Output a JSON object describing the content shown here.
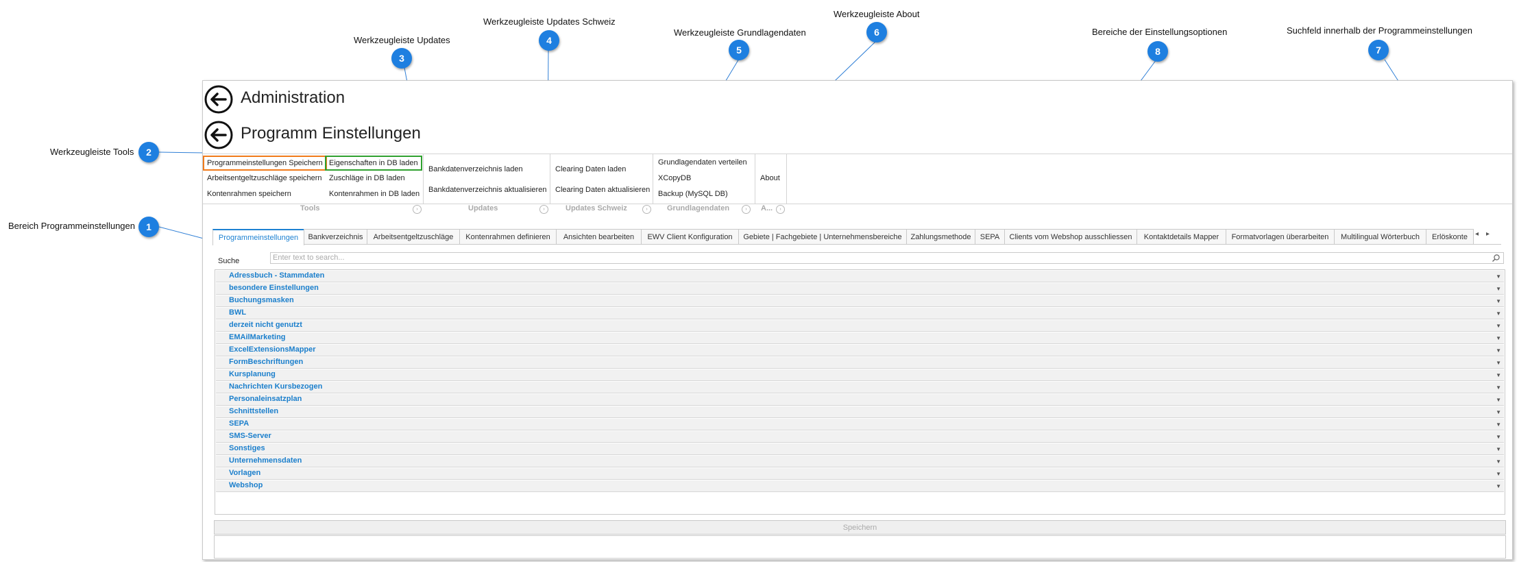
{
  "annotations": [
    {
      "num": "1",
      "label": "Bereich Programmeinstellungen"
    },
    {
      "num": "2",
      "label": "Werkzeugleiste Tools"
    },
    {
      "num": "3",
      "label": "Werkzeugleiste Updates"
    },
    {
      "num": "4",
      "label": "Werkzeugleiste Updates Schweiz"
    },
    {
      "num": "5",
      "label": "Werkzeugleiste Grundlagendaten"
    },
    {
      "num": "6",
      "label": "Werkzeugleiste About"
    },
    {
      "num": "7",
      "label": "Suchfeld innerhalb der Programmeinstellungen"
    },
    {
      "num": "8",
      "label": "Bereiche der Einstellungsoptionen"
    }
  ],
  "header": {
    "breadcrumb": "Administration",
    "title": "Programm Einstellungen"
  },
  "ribbon": {
    "tools": {
      "col1": [
        "Programmeinstellungen Speichern",
        "Arbeitsentgeltzuschläge speichern",
        "Kontenrahmen speichern"
      ],
      "col2": [
        "Eigenschaften in DB laden",
        "Zuschläge in DB laden",
        "Kontenrahmen in DB laden"
      ]
    },
    "updates": [
      "Bankdatenverzeichnis laden",
      "Bankdatenverzeichnis aktualisieren"
    ],
    "updates_schweiz": [
      "Clearing Daten laden",
      "Clearing Daten aktualisieren"
    ],
    "grundlagendaten": [
      "Grundlagendaten verteilen",
      "XCopyDB",
      "Backup (MySQL DB)"
    ],
    "about": "About"
  },
  "group_labels": [
    "Tools",
    "Updates",
    "Updates Schweiz",
    "Grundlagendaten",
    "A..."
  ],
  "tabs": [
    "Programmeinstellungen",
    "Bankverzeichnis",
    "Arbeitsentgeltzuschläge",
    "Kontenrahmen definieren",
    "Ansichten bearbeiten",
    "EWV Client Konfiguration",
    "Gebiete | Fachgebiete | Unternehmensbereiche",
    "Zahlungsmethode",
    "SEPA",
    "Clients vom Webshop ausschliessen",
    "Kontaktdetails Mapper",
    "Formatvorlagen überarbeiten",
    "Multilingual Wörterbuch",
    "Erlöskonte"
  ],
  "search": {
    "label": "Suche",
    "placeholder": "Enter text to search..."
  },
  "categories": [
    "Adressbuch - Stammdaten",
    "besondere Einstellungen",
    "Buchungsmasken",
    "BWL",
    "derzeit nicht genutzt",
    "EMAilMarketing",
    "ExcelExtensionsMapper",
    "FormBeschriftungen",
    "Kursplanung",
    "Nachrichten Kursbezogen",
    "Personaleinsatzplan",
    "Schnittstellen",
    "SEPA",
    "SMS-Server",
    "Sonstiges",
    "Unternehmensdaten",
    "Vorlagen",
    "Webshop"
  ],
  "save_label": "Speichern",
  "colors": {
    "accent": "#1e7fe0",
    "category_text": "#1b7fcc",
    "tools_highlight": "#f07a1a",
    "eigenschaften_highlight": "#2fa02f"
  }
}
